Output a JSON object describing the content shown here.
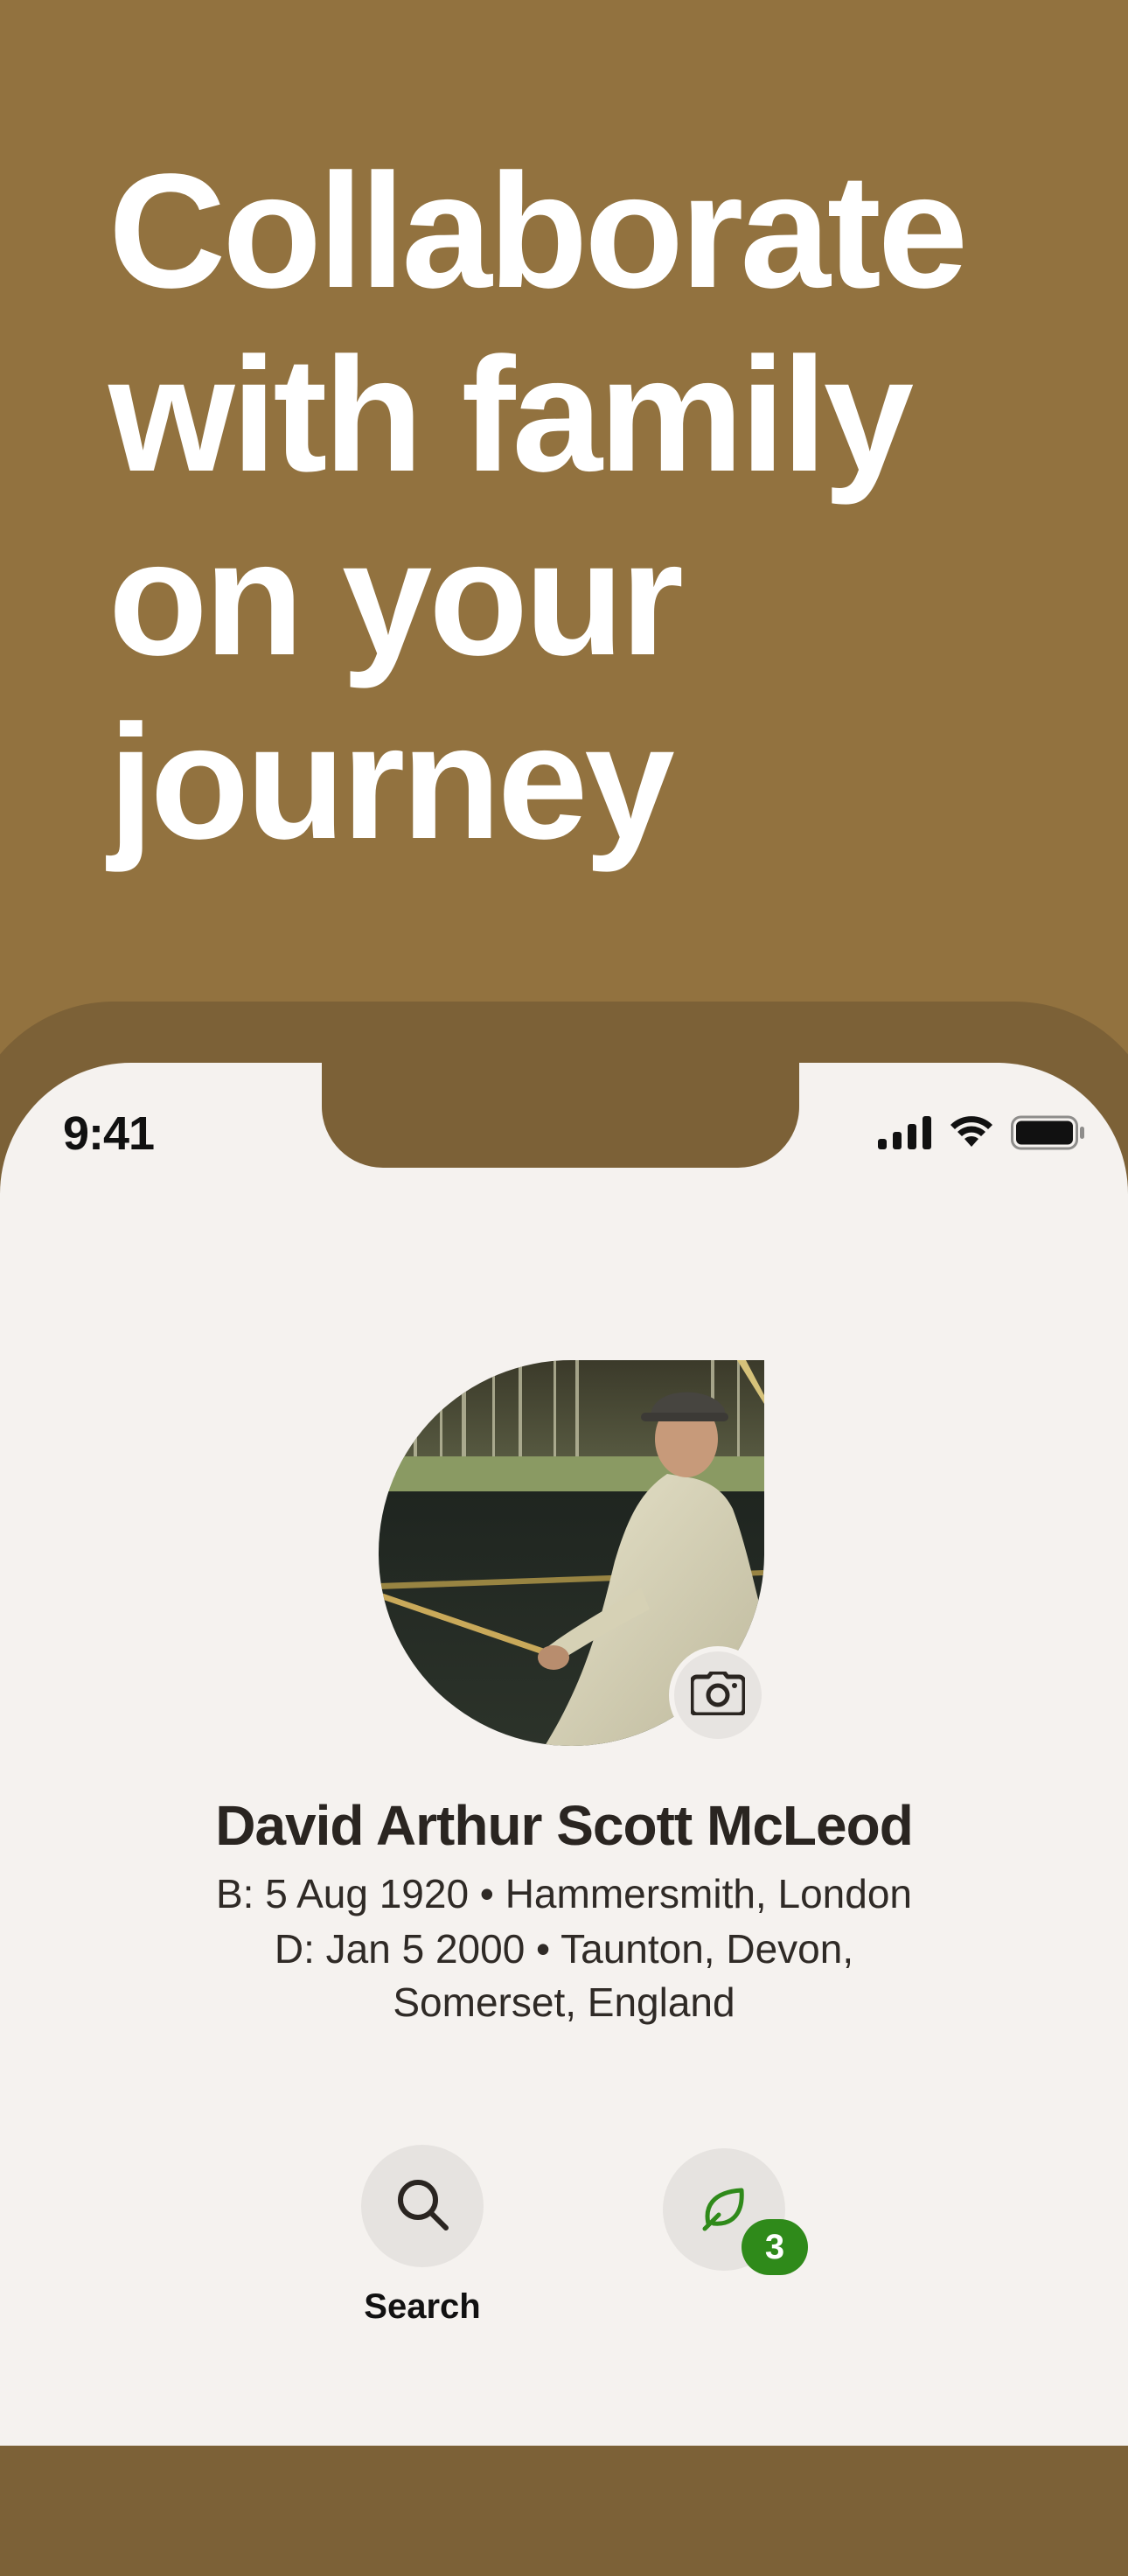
{
  "headline": {
    "lines": [
      "Collaborate",
      "with family",
      "on your",
      "journey"
    ]
  },
  "status_bar": {
    "time": "9:41",
    "icons": [
      "cellular-signal-icon",
      "wifi-icon",
      "battery-icon"
    ]
  },
  "profile": {
    "name": "David Arthur Scott McLeod",
    "birth": "B: 5 Aug 1920 • Hammersmith, London",
    "death_line1": "D: Jan 5 2000 • Taunton, Devon,",
    "death_line2": "Somerset, England",
    "photo_icon": "camera-icon"
  },
  "actions": {
    "search_label": "Search",
    "search_icon": "magnifier-icon",
    "hints_icon": "leaf-icon",
    "hints_count": "3"
  },
  "colors": {
    "background": "#92723f",
    "frame": "#7c6137",
    "screen": "#f5f2ef",
    "badge": "#2f8a1a",
    "text_dark": "#2a2521"
  }
}
